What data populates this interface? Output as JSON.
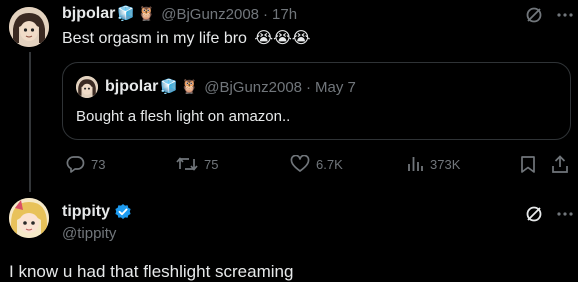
{
  "post": {
    "display_name": "bjpolar",
    "handle": "@BjGunz2008",
    "separator": "·",
    "time": "17h",
    "text": "Best orgasm in my life bro",
    "emoji": "😭😭😭",
    "badge_emojis": [
      "🧊",
      "🦉"
    ]
  },
  "quote": {
    "display_name": "bjpolar",
    "handle": "@BjGunz2008",
    "separator": "·",
    "date": "May 7",
    "text": "Bought a flesh light on amazon.."
  },
  "actions": {
    "replies": "73",
    "reposts": "75",
    "likes": "6.7K",
    "views": "373K"
  },
  "reply": {
    "display_name": "tippity",
    "handle": "@tippity",
    "text": "I know u had that fleshlight screaming"
  },
  "colors": {
    "background": "#000000",
    "text": "#e7e9ea",
    "muted": "#71767b",
    "border": "#2f3336",
    "verified": "#1d9bf0"
  }
}
